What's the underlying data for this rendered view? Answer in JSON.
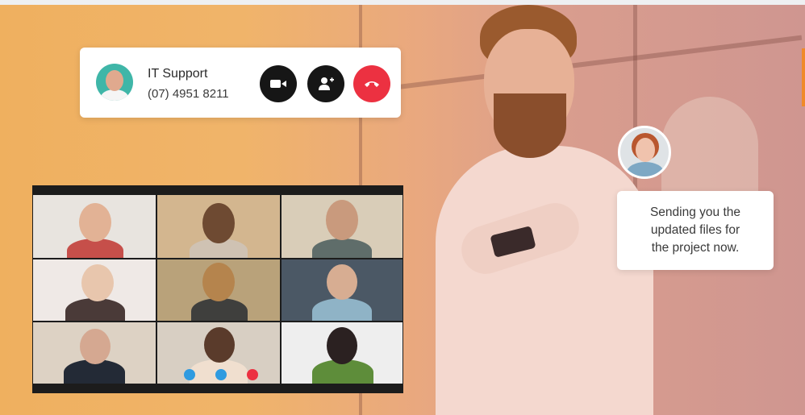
{
  "call_card": {
    "contact_name": "IT Support",
    "contact_phone": "(07) 4951 8211",
    "buttons": [
      {
        "name": "video-button",
        "icon": "video-camera-icon",
        "color": "#161616"
      },
      {
        "name": "add-participant-button",
        "icon": "add-user-icon",
        "color": "#161616"
      },
      {
        "name": "end-call-button",
        "icon": "phone-hangup-icon",
        "color": "#ec3141"
      }
    ]
  },
  "video_grid": {
    "participants": 9,
    "controls": [
      {
        "name": "mic-icon",
        "color": "#2f9be0"
      },
      {
        "name": "video-camera-icon",
        "color": "#2f9be0"
      },
      {
        "name": "end-call-icon",
        "color": "#ec3141"
      }
    ]
  },
  "chat": {
    "message_lines": [
      "Sending you the",
      "updated files for",
      "the project now."
    ]
  },
  "colors": {
    "background_warm": "#efb05f",
    "background_rose": "#cf9690",
    "end_call": "#ec3141",
    "button_dark": "#161616"
  }
}
